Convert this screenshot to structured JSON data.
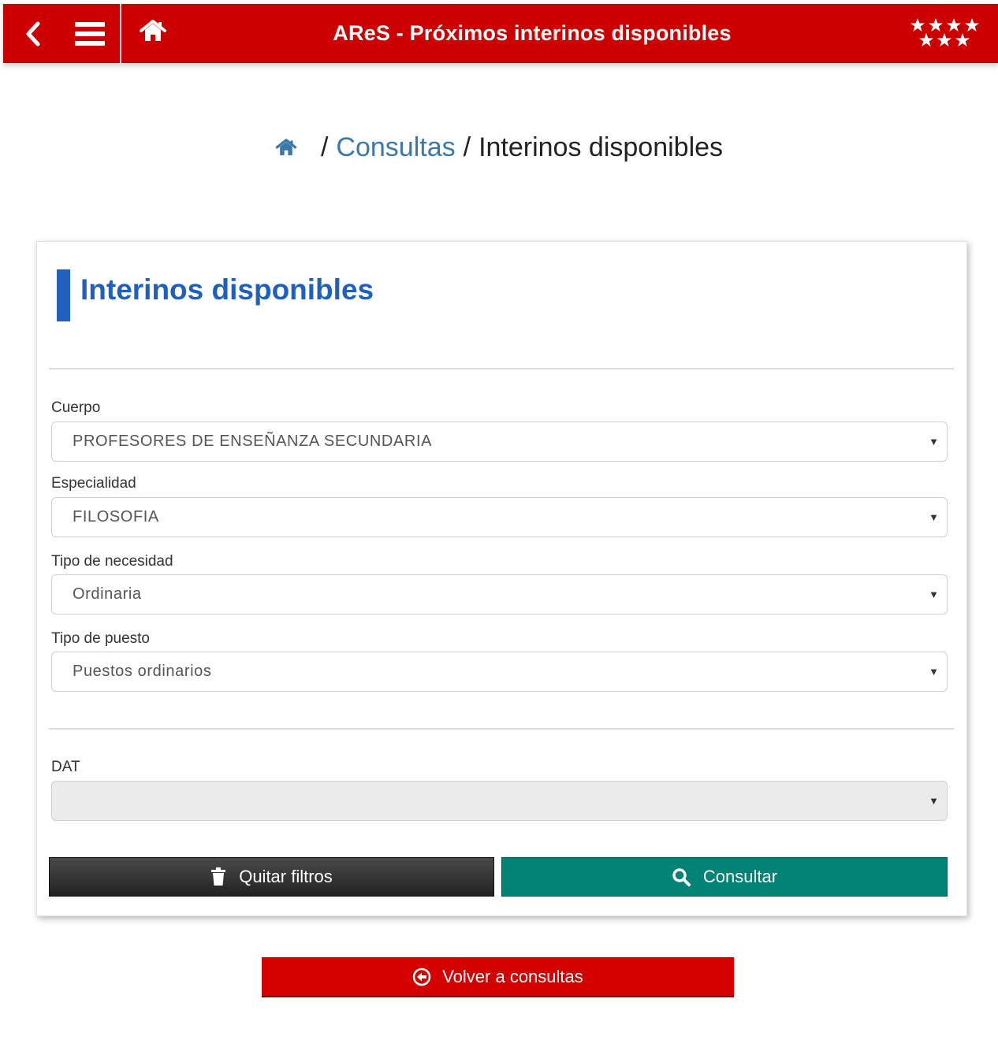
{
  "header": {
    "title": "AReS - Próximos interinos disponibles"
  },
  "breadcrumb": {
    "separator": "/",
    "items": [
      "Consultas",
      "Interinos disponibles"
    ]
  },
  "card": {
    "title": "Interinos disponibles",
    "fields": {
      "cuerpo": {
        "label": "Cuerpo",
        "value": "PROFESORES DE ENSEÑANZA SECUNDARIA"
      },
      "especialidad": {
        "label": "Especialidad",
        "value": "FILOSOFIA"
      },
      "tipo_necesidad": {
        "label": "Tipo de necesidad",
        "value": "Ordinaria"
      },
      "tipo_puesto": {
        "label": "Tipo de puesto",
        "value": "Puestos ordinarios"
      },
      "dat": {
        "label": "DAT",
        "value": ""
      }
    },
    "buttons": {
      "clear": "Quitar filtros",
      "search": "Consultar"
    }
  },
  "back_button": "Volver a consultas",
  "colors": {
    "header": "#cc0000",
    "title_blue": "#1f5fbd",
    "link_blue": "#3a78a8",
    "search_green": "#008374",
    "back_red": "#d40000"
  },
  "icons": {
    "back": "chevron-left-icon",
    "menu": "hamburger-menu-icon",
    "home": "home-icon",
    "logo": "stars-logo",
    "caret": "caret-down-icon",
    "trash": "trash-icon",
    "search": "search-icon",
    "back_circle": "circle-arrow-left-icon"
  }
}
